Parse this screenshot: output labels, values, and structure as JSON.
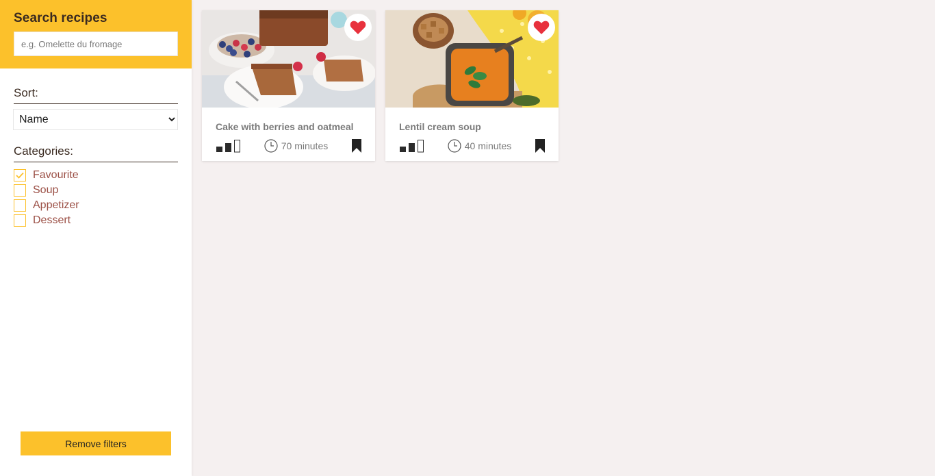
{
  "search": {
    "title": "Search recipes",
    "placeholder": "e.g. Omelette du fromage"
  },
  "sort": {
    "title": "Sort:",
    "selected": "Name",
    "options": [
      "Name"
    ]
  },
  "categories": {
    "title": "Categories:",
    "items": [
      {
        "label": "Favourite",
        "checked": true
      },
      {
        "label": "Soup",
        "checked": false
      },
      {
        "label": "Appetizer",
        "checked": false
      },
      {
        "label": "Dessert",
        "checked": false
      }
    ]
  },
  "remove_filters": "Remove filters",
  "recipes": [
    {
      "title": "Cake with berries and oatmeal",
      "time": "70 minutes",
      "difficulty_level": 2,
      "difficulty_max": 3,
      "favourite": true
    },
    {
      "title": "Lentil cream soup",
      "time": "40 minutes",
      "difficulty_level": 2,
      "difficulty_max": 3,
      "favourite": true
    }
  ],
  "colors": {
    "accent": "#fcc12b",
    "heart": "#e8313d",
    "background": "#f5f0f0",
    "category_text": "#9b4f45"
  }
}
